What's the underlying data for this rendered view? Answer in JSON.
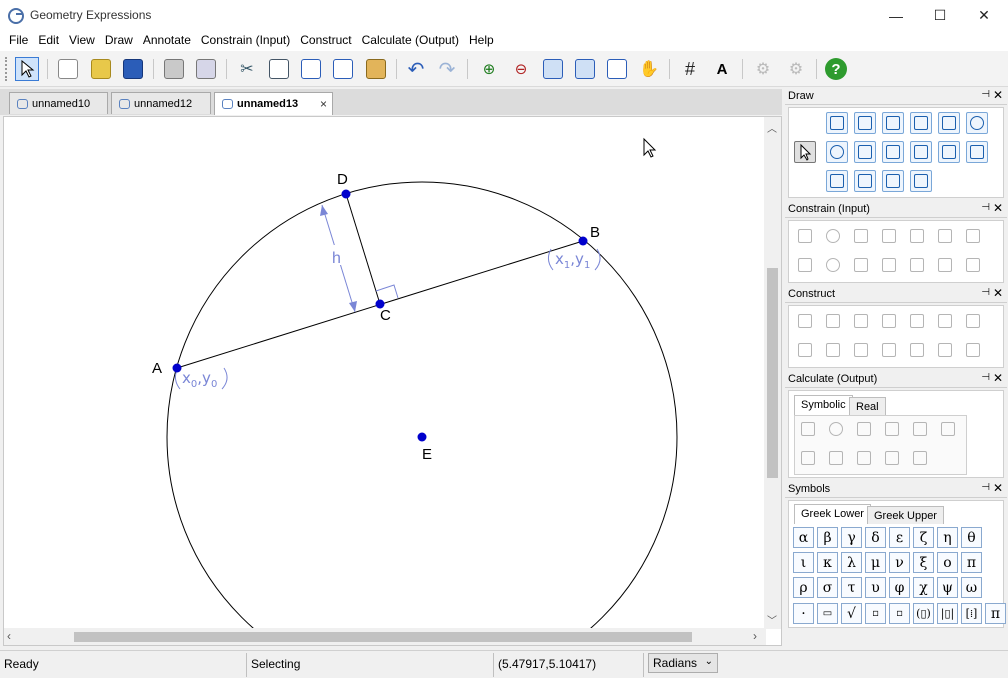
{
  "window": {
    "title": "Geometry Expressions",
    "minimize": "—",
    "maximize": "☐",
    "close": "✕"
  },
  "menu": [
    "File",
    "Edit",
    "View",
    "Draw",
    "Annotate",
    "Constrain (Input)",
    "Construct",
    "Calculate (Output)",
    "Help"
  ],
  "tabs": [
    {
      "label": "unnamed10",
      "active": false
    },
    {
      "label": "unnamed12",
      "active": false
    },
    {
      "label": "unnamed13",
      "active": true
    }
  ],
  "tab_close": "×",
  "geometry": {
    "points": {
      "A": "A",
      "B": "B",
      "C": "C",
      "D": "D",
      "E": "E"
    },
    "h_label": "h",
    "coord_a": {
      "x": "x",
      "sub_x": "0",
      "y": "y",
      "sub_y": "0"
    },
    "coord_b": {
      "x": "x",
      "sub_x": "1",
      "y": "y",
      "sub_y": "1"
    }
  },
  "panels": {
    "draw": "Draw",
    "constrain": "Constrain (Input)",
    "construct": "Construct",
    "calculate": {
      "title": "Calculate (Output)",
      "tabs": [
        "Symbolic",
        "Real"
      ]
    },
    "symbols": {
      "title": "Symbols",
      "tabs": [
        "Greek Lower",
        "Greek Upper"
      ],
      "greek": [
        "α",
        "β",
        "γ",
        "δ",
        "ε",
        "ζ",
        "η",
        "θ",
        "ι",
        "κ",
        "λ",
        "μ",
        "ν",
        "ξ",
        "ο",
        "π",
        "ρ",
        "σ",
        "τ",
        "υ",
        "φ",
        "χ",
        "ψ",
        "ω"
      ],
      "pi": "π"
    },
    "pin": "📌",
    "close": "✕"
  },
  "status": {
    "ready": "Ready",
    "mode": "Selecting",
    "coords": "(5.47917,5.10417)",
    "units": "Radians"
  },
  "colors": {
    "accent": "#0000cc",
    "annotation": "#7a86d6"
  }
}
